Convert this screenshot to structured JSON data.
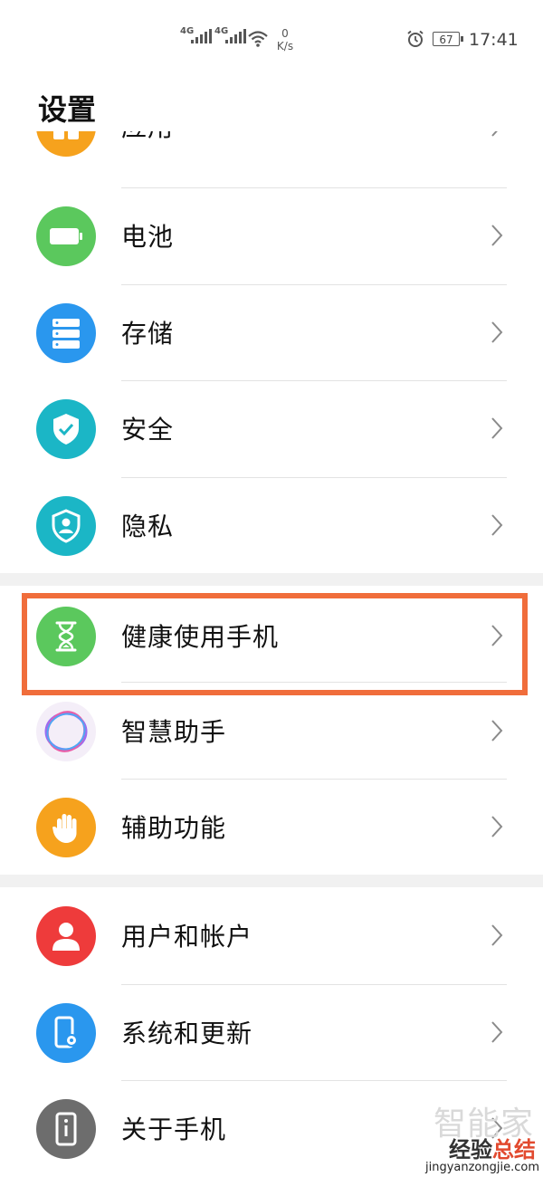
{
  "status_bar": {
    "network_1": "4G",
    "network_2": "4G",
    "speed_value": "0",
    "speed_unit": "K/s",
    "battery_level": "67",
    "time": "17:41"
  },
  "page_title": "设置",
  "items": [
    {
      "label": "应用",
      "color": "#f6a21d",
      "icon": "apps-icon"
    },
    {
      "label": "电池",
      "color": "#5bc85d",
      "icon": "battery-icon"
    },
    {
      "label": "存储",
      "color": "#2a97ee",
      "icon": "storage-icon"
    },
    {
      "label": "安全",
      "color": "#1bb6c6",
      "icon": "shield-check-icon"
    },
    {
      "label": "隐私",
      "color": "#1bb6c6",
      "icon": "privacy-icon"
    },
    {
      "label": "健康使用手机",
      "color": "#5bc85d",
      "icon": "hourglass-icon"
    },
    {
      "label": "智慧助手",
      "color": "#b574ef",
      "icon": "assistant-ring-icon"
    },
    {
      "label": "辅助功能",
      "color": "#f6a21d",
      "icon": "hand-icon"
    },
    {
      "label": "用户和帐户",
      "color": "#ee3b3b",
      "icon": "user-icon"
    },
    {
      "label": "系统和更新",
      "color": "#2a97ee",
      "icon": "phone-settings-icon"
    },
    {
      "label": "关于手机",
      "color": "#6d6d6d",
      "icon": "phone-info-icon"
    }
  ],
  "watermark": {
    "big": "智能家",
    "brand_a": "经验",
    "brand_b": "总结",
    "url": "jingyanzongjie.com"
  }
}
